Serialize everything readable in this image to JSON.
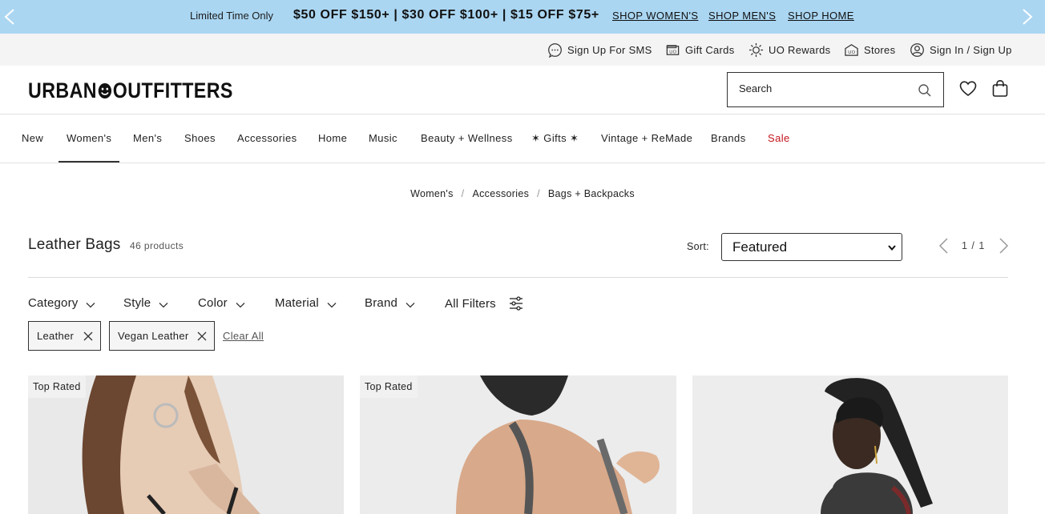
{
  "promo": {
    "limited": "Limited Time Only",
    "offer": "$50 OFF $150+ | $30 OFF $100+ | $15 OFF $75+",
    "links": [
      "SHOP WOMEN'S",
      "SHOP MEN'S",
      "SHOP HOME"
    ],
    "bg_color": "#aad6f2"
  },
  "utility": {
    "items": [
      {
        "label": "Sign Up For SMS",
        "icon": "chat-icon"
      },
      {
        "label": "Gift Cards",
        "icon": "gift-card-icon"
      },
      {
        "label": "UO Rewards",
        "icon": "sun-icon"
      },
      {
        "label": "Stores",
        "icon": "store-icon"
      },
      {
        "label": "Sign In / Sign Up",
        "icon": "user-icon"
      }
    ]
  },
  "header": {
    "logo_left": "URBAN",
    "logo_right": "OUTFITTERS",
    "search_placeholder": "Search"
  },
  "nav": {
    "items": [
      "New",
      "Women's",
      "Men's",
      "Shoes",
      "Accessories",
      "Home",
      "Music",
      "Beauty + Wellness",
      "✶ Gifts ✶",
      "Vintage + ReMade",
      "Brands",
      "Sale"
    ],
    "active": "Women's",
    "sale_color": "#c4141c"
  },
  "breadcrumb": [
    "Women's",
    "Accessories",
    "Bags + Backpacks"
  ],
  "listing": {
    "title": "Leather Bags",
    "count": "46 products",
    "sort_label": "Sort:",
    "sort_value": "Featured",
    "page": "1 / 1"
  },
  "filters": [
    "Category",
    "Style",
    "Color",
    "Material",
    "Brand",
    "All Filters"
  ],
  "chips": [
    "Leather",
    "Vegan Leather"
  ],
  "clear_all": "Clear All",
  "products": [
    {
      "badge": "Top Rated"
    },
    {
      "badge": "Top Rated"
    },
    {
      "badge": ""
    }
  ]
}
